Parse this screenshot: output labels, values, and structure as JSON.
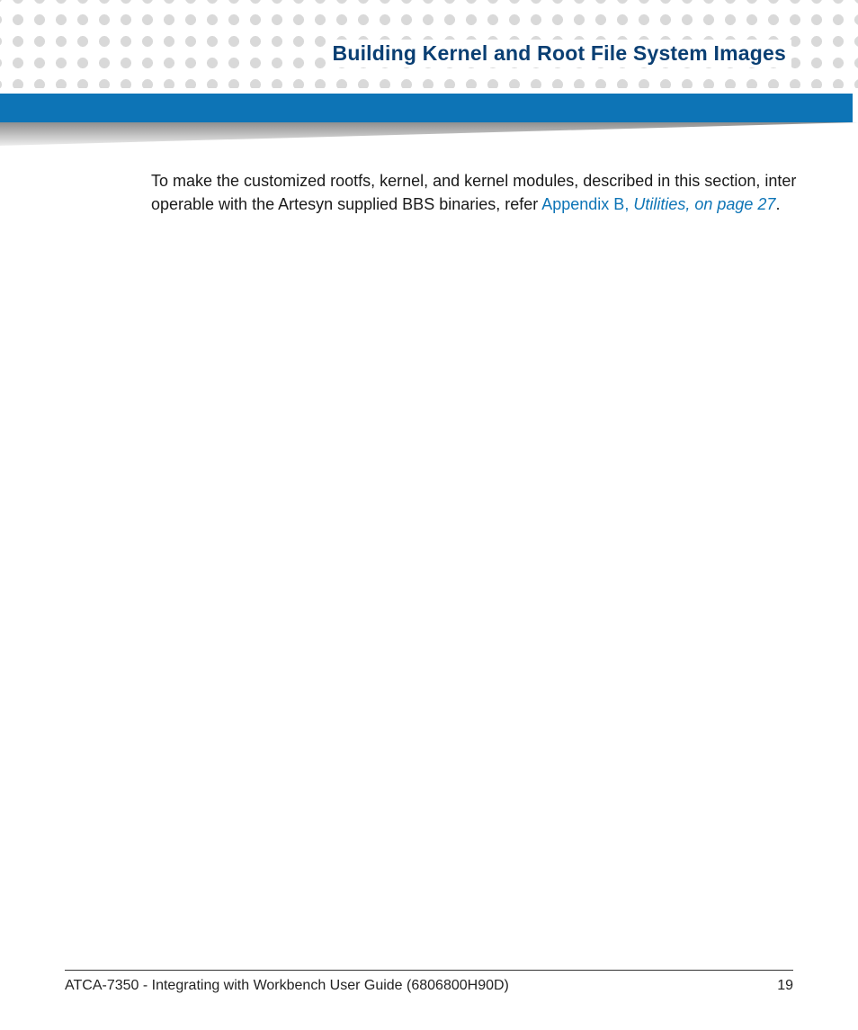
{
  "header": {
    "title": "Building Kernel and Root File System Images"
  },
  "content": {
    "paragraph_prefix": "To make the customized rootfs, kernel, and kernel modules, described in this section, inter operable with the Artesyn supplied BBS binaries, refer ",
    "link_plain": "Appendix B, ",
    "link_italic": "Utilities, on page 27",
    "paragraph_suffix": "."
  },
  "footer": {
    "doc_title": "ATCA-7350 - Integrating with Workbench User Guide (6806800H90D)",
    "page_number": "19"
  }
}
